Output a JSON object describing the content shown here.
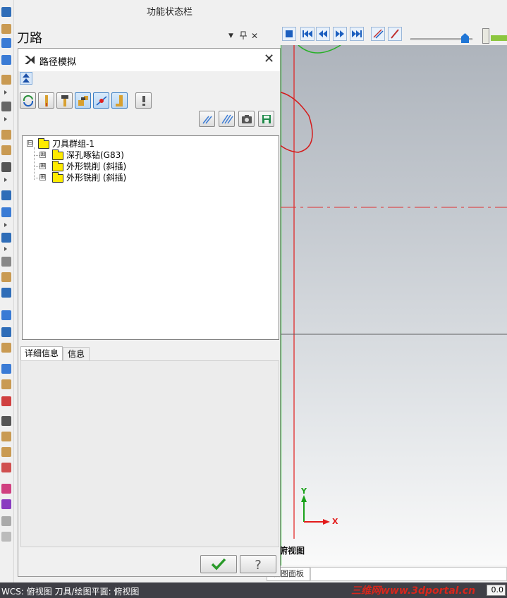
{
  "window": {
    "function_bar_title": "功能状态栏"
  },
  "toolpath_panel": {
    "title": "刀路",
    "header_buttons": {
      "dropdown": "▼",
      "pin": "ㅁ",
      "close": "✕"
    }
  },
  "dialog": {
    "title": "路径模拟",
    "close_glyph": "✕",
    "collapse_icon": "double-chevron-up-icon",
    "tool_buttons": [
      {
        "name": "reload-path-button",
        "icon": "cycle-icon"
      },
      {
        "name": "show-tool-button",
        "icon": "tool-icon"
      },
      {
        "name": "show-holder-button",
        "icon": "holder-icon"
      },
      {
        "name": "show-tool-color-button",
        "icon": "tool-color-icon",
        "active": true
      },
      {
        "name": "show-endpoints-button",
        "icon": "endpoints-icon",
        "active": true
      },
      {
        "name": "show-shank-button",
        "icon": "shank-icon",
        "active": true
      },
      {
        "name": "tool-options-button",
        "icon": "exclamation-tool-icon"
      }
    ],
    "action_buttons": [
      {
        "name": "clear-path-button",
        "icon": "single-path-icon"
      },
      {
        "name": "show-all-paths-button",
        "icon": "multi-path-icon"
      },
      {
        "name": "screenshot-button",
        "icon": "camera-icon"
      },
      {
        "name": "save-geometry-button",
        "icon": "save-icon"
      }
    ],
    "tree": {
      "root": {
        "label": "刀具群组-1",
        "expander": "⊟"
      },
      "children": [
        {
          "label": "深孔啄钻(G83)",
          "expander": "⊞"
        },
        {
          "label": "外形铣削 (斜插)",
          "expander": "⊞"
        },
        {
          "label": "外形铣削 (斜插)",
          "expander": "⊞"
        }
      ]
    },
    "tabs": [
      {
        "label": "详细信息",
        "selected": true
      },
      {
        "label": "信息",
        "selected": false
      }
    ],
    "ok_icon": "checkmark-icon",
    "help_icon": "question-icon"
  },
  "viewport": {
    "axis_x_label": "X",
    "axis_y_label": "Y",
    "view_name": "俯视图",
    "bottom_tab": "视图面板",
    "colors": {
      "x_axis": "#e21b1b",
      "y_axis": "#1aa21a",
      "centerline": "#e03030",
      "annotation": "#d41a1a"
    }
  },
  "sim_toolbar": {
    "buttons": [
      "play-icon",
      "stop-icon",
      "first-icon",
      "step-back-icon",
      "step-forward-icon",
      "last-icon",
      "path-trace-icon",
      "tool-trace-icon"
    ]
  },
  "status_bar": {
    "text": "WCS: 俯视图  刀具/绘图平面: 俯视图",
    "watermark": "三维网www.3dportal.cn",
    "zoom_value": "0.0"
  }
}
